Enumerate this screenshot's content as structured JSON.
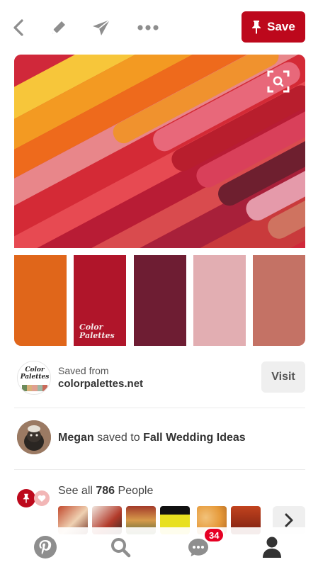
{
  "toolbar": {
    "icons": [
      "back-arrow-icon",
      "edit-pencil-icon",
      "send-icon",
      "more-dots-icon"
    ],
    "save_label": "Save"
  },
  "pin": {
    "palette_logo_line1": "Color",
    "palette_logo_line2": "Palettes",
    "palette_colors": [
      "#e0661a",
      "#b0152a",
      "#6e1d33",
      "#e2aeb2",
      "#c47265"
    ]
  },
  "source": {
    "logo_line1": "Color",
    "logo_line2": "Palettes",
    "saved_from_label": "Saved from",
    "site": "colorpalettes.net",
    "visit_label": "Visit"
  },
  "saver": {
    "name": "Megan",
    "action": "saved to",
    "board": "Fall Wedding Ideas"
  },
  "people": {
    "prefix": "See all",
    "count": "786",
    "suffix": "People"
  },
  "nav": {
    "items": [
      "pinterest-home-icon",
      "search-icon",
      "messages-icon",
      "profile-icon"
    ],
    "messages_badge": "34"
  },
  "colors": {
    "brand_red": "#bd081c",
    "badge_red": "#e60023",
    "icon_gray": "#8e8e8e"
  }
}
